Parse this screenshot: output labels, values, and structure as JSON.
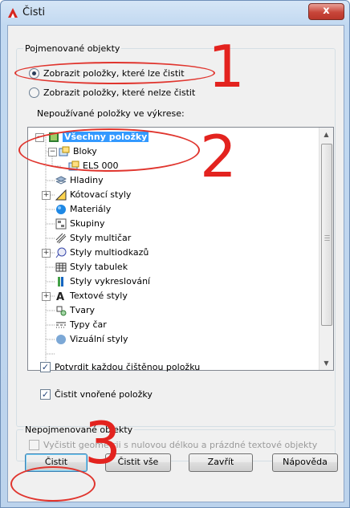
{
  "window": {
    "title": "Čisti",
    "close_label": "x"
  },
  "named_group": {
    "legend": "Pojmenované objekty",
    "options": [
      {
        "label": "Zobrazit položky, které lze čistit",
        "checked": true
      },
      {
        "label": "Zobrazit položky, které nelze čistit",
        "checked": false
      }
    ],
    "tree_caption": "Nepoužívané položky ve výkrese:",
    "tree_items": [
      {
        "label": "Všechny položky",
        "icon": "all-items-icon",
        "selected": true
      },
      {
        "label": "Bloky",
        "icon": "blocks-icon"
      },
      {
        "label": "ELS 000",
        "icon": "block-icon"
      },
      {
        "label": "Hladiny",
        "icon": "layers-icon"
      },
      {
        "label": "Kótovací styly",
        "icon": "dimension-styles-icon"
      },
      {
        "label": "Materiály",
        "icon": "materials-icon"
      },
      {
        "label": "Skupiny",
        "icon": "groups-icon"
      },
      {
        "label": "Styly multičar",
        "icon": "multiline-styles-icon"
      },
      {
        "label": "Styly multiodkazů",
        "icon": "multileader-styles-icon"
      },
      {
        "label": "Styly tabulek",
        "icon": "table-styles-icon"
      },
      {
        "label": "Styly vykreslování",
        "icon": "plot-styles-icon"
      },
      {
        "label": "Textové styly",
        "icon": "text-styles-icon"
      },
      {
        "label": "Tvary",
        "icon": "shapes-icon"
      },
      {
        "label": "Typy čar",
        "icon": "linetypes-icon"
      },
      {
        "label": "Vizuální styly",
        "icon": "visual-styles-icon"
      }
    ],
    "confirm_label": "Potvrdit každou čištěnou položku",
    "confirm_checked": true,
    "nested_label": "Čistit vnořené položky",
    "nested_checked": true
  },
  "unnamed_group": {
    "legend": "Nepojmenované objekty",
    "option_label": "Vyčistit geometrii s nulovou délkou a prázdné textové objekty",
    "option_checked": false
  },
  "buttons": {
    "purge": "Čistit",
    "purge_all": "Čistit vše",
    "close": "Zavřít",
    "help": "Nápověda"
  },
  "annotations": {
    "one": "1",
    "two": "2",
    "three": "3"
  },
  "colors": {
    "annotation": "#e3231f",
    "selection": "#3399ff"
  }
}
